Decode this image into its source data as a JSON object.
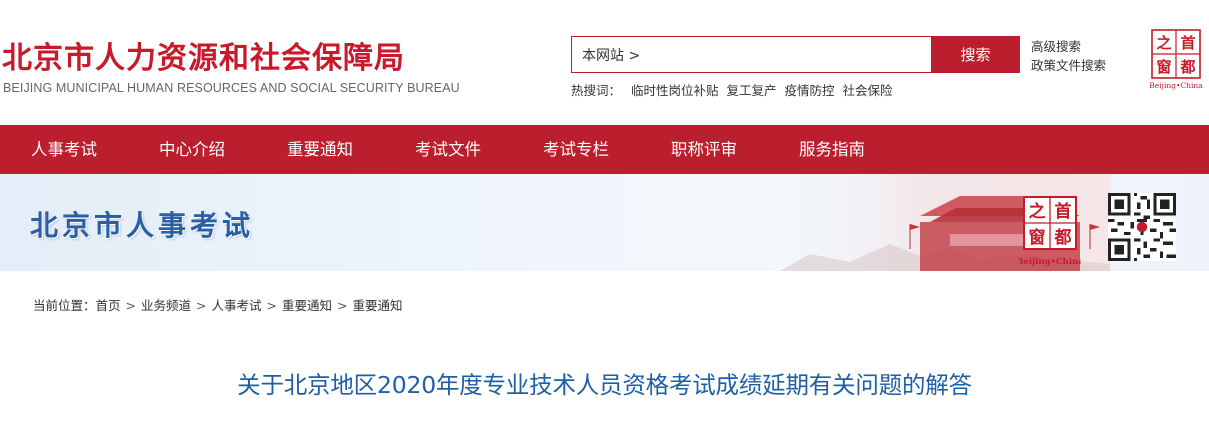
{
  "header": {
    "title": "北京市人力资源和社会保障局",
    "subtitle": "BEIJING MUNICIPAL HUMAN RESOURCES AND SOCIAL SECURITY BUREAU",
    "search": {
      "value": "本网站 >",
      "button": "搜索"
    },
    "hot": {
      "label": "热搜词：",
      "items": [
        "临时性岗位补贴",
        "复工复产",
        "疫情防控",
        "社会保险"
      ]
    },
    "advanced_search": "高级搜索",
    "policy_search": "政策文件搜索",
    "badge": {
      "chars": [
        "首",
        "都",
        "之",
        "窗"
      ],
      "caption": "Beijing•China"
    }
  },
  "nav": {
    "items": [
      "人事考试",
      "中心介绍",
      "重要通知",
      "考试文件",
      "考试专栏",
      "职称评审",
      "服务指南"
    ]
  },
  "banner": {
    "title": "北京市人事考试",
    "badge": {
      "chars": [
        "首",
        "都",
        "之",
        "窗"
      ],
      "caption": "Beijing•China"
    }
  },
  "breadcrumb": {
    "label": "当前位置：",
    "items": [
      "首页",
      "业务频道",
      "人事考试",
      "重要通知",
      "重要通知"
    ]
  },
  "article": {
    "title": "关于北京地区2020年度专业技术人员资格考试成绩延期有关问题的解答"
  },
  "colors": {
    "brand_red": "#bb1e2d",
    "title_red": "#c81a2b",
    "link_blue": "#1f5fa6",
    "banner_blue": "#2a5fa8"
  }
}
